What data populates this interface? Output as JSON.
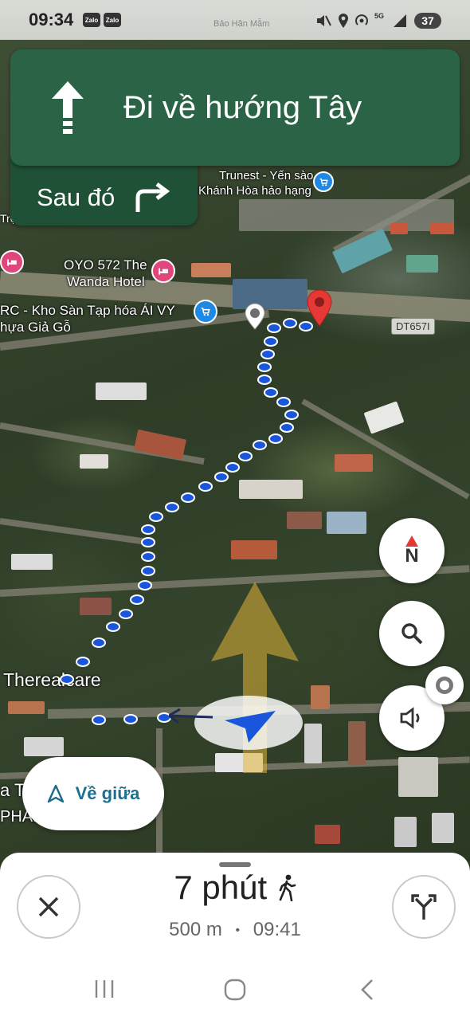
{
  "status_bar": {
    "time": "09:34",
    "app_icons": [
      "Zalo",
      "Zalo"
    ],
    "battery": "37",
    "overlay_text": "Bảo Hân Mẫm"
  },
  "navigation": {
    "instruction": "Đi về hướng Tây",
    "then_label": "Sau đó"
  },
  "map": {
    "labels": {
      "trunest": "Trunest - Yến sào",
      "trunest_sub": "Khánh Hòa hảo hạng",
      "oyo_line1": "OYO 572 The",
      "oyo_line2": "Wanda Hotel",
      "kho_san": "RC - Kho Sàn  Tạp hóa ÁI VY",
      "gia_go": "hựa Giả Gỗ",
      "tro": "Trọ",
      "road_badge": "DT657I",
      "therealcare": "Therealcare",
      "phan": "PHAN",
      "a_t": "a T"
    }
  },
  "controls": {
    "compass_letter": "N",
    "recenter_label": "Về giữa"
  },
  "trip": {
    "duration": "7 phút",
    "distance": "500 m",
    "separator": "•",
    "eta": "09:41"
  },
  "colors": {
    "banner": "#2b6346",
    "banner_then": "#1f5136",
    "route": "#1a56db",
    "destination_pin": "#e53935",
    "poi_hotel": "#e0457b",
    "poi_shop": "#1e88e5"
  }
}
